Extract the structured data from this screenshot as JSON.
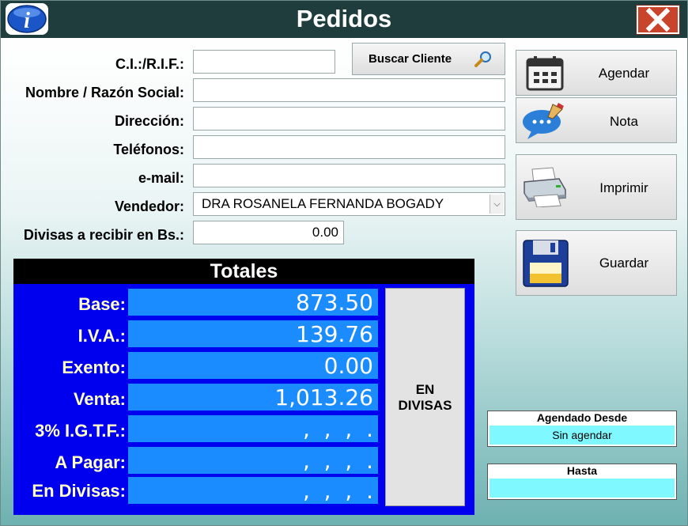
{
  "window": {
    "title": "Pedidos"
  },
  "colors": {
    "titlebar": "#1f3d3d",
    "totals_panel": "#0000ee",
    "totals_value_bg": "#1a8cff",
    "schedule_bg": "#7ff9ff"
  },
  "form": {
    "ci_rif": {
      "label": "C.I.:/R.I.F.:",
      "value": ""
    },
    "search_button": "Buscar Cliente",
    "nombre": {
      "label": "Nombre / Razón Social:",
      "value": ""
    },
    "direccion": {
      "label": "Dirección:",
      "value": ""
    },
    "telefonos": {
      "label": "Teléfonos:",
      "value": ""
    },
    "email": {
      "label": "e-mail:",
      "value": ""
    },
    "vendedor": {
      "label": "Vendedor:",
      "value": "DRA ROSANELA FERNANDA BOGADY"
    },
    "divisas": {
      "label": "Divisas a recibir en Bs.:",
      "value": "0.00"
    }
  },
  "actions": {
    "agendar": "Agendar",
    "nota": "Nota",
    "imprimir": "Imprimir",
    "guardar": "Guardar"
  },
  "totals": {
    "title": "Totales",
    "rows": [
      {
        "label": "Base:",
        "value": "873.50"
      },
      {
        "label": "I.V.A.:",
        "value": "139.76"
      },
      {
        "label": "Exento:",
        "value": "0.00"
      },
      {
        "label": "Venta:",
        "value": "1,013.26"
      },
      {
        "label": "3% I.G.T.F.:",
        "value": ",  ,  ,  ."
      },
      {
        "label": "A Pagar:",
        "value": ",  ,  ,  ."
      },
      {
        "label": "En Divisas:",
        "value": ",  ,  ,  ."
      }
    ],
    "en_divisas_line1": "EN",
    "en_divisas_line2": "DIVISAS"
  },
  "schedule": {
    "desde_label": "Agendado Desde",
    "desde_value": "Sin agendar",
    "hasta_label": "Hasta",
    "hasta_value": ""
  }
}
